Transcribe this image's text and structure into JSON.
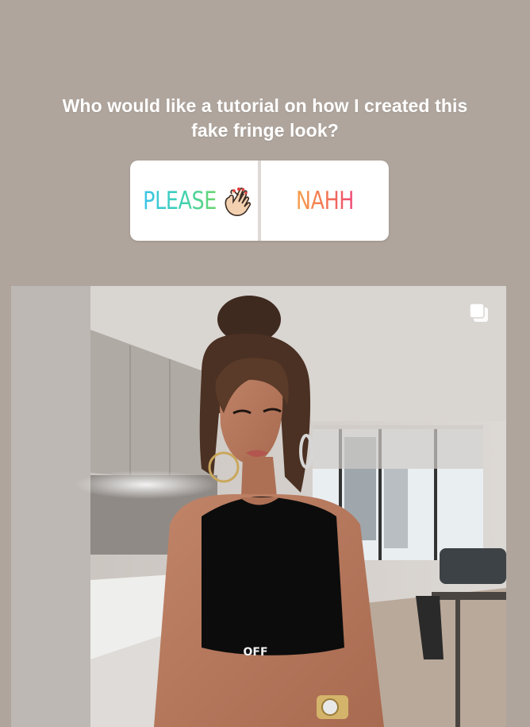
{
  "story": {
    "question": "Who would like a tutorial on how I created this fake fringe look?",
    "poll": {
      "option_a": "PLEASE",
      "option_a_emoji": "clapping-hands-icon",
      "option_b": "NAHH"
    }
  },
  "post": {
    "multi_image_icon": "carousel-icon",
    "top_print": "OFF"
  },
  "colors": {
    "background": "#afa59d",
    "poll_a_gradient": [
      "#3cc4e9",
      "#6cd66e"
    ],
    "poll_b_gradient": [
      "#f7a04a",
      "#ee4a78"
    ]
  }
}
